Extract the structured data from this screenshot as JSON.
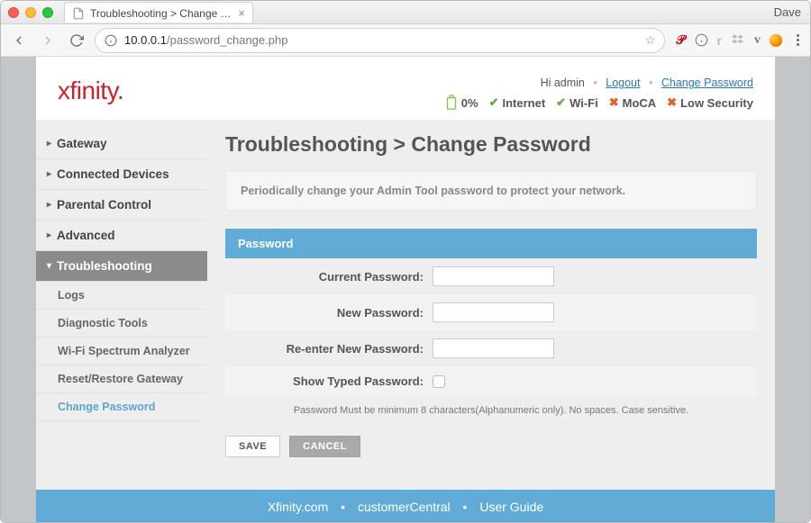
{
  "browser": {
    "profile_name": "Dave",
    "tab_title": "Troubleshooting > Change Pas",
    "url_host": "10.0.0.1",
    "url_path": "/password_change.php"
  },
  "header": {
    "logo_text": "xfinity",
    "greeting": "Hi admin",
    "logout_label": "Logout",
    "change_pw_label": "Change Password",
    "battery_pct": "0%",
    "status": {
      "internet": "Internet",
      "wifi": "Wi-Fi",
      "moca": "MoCA",
      "security": "Low Security"
    }
  },
  "sidebar": {
    "items": [
      {
        "label": "Gateway"
      },
      {
        "label": "Connected Devices"
      },
      {
        "label": "Parental Control"
      },
      {
        "label": "Advanced"
      },
      {
        "label": "Troubleshooting"
      }
    ],
    "sub": [
      {
        "label": "Logs"
      },
      {
        "label": "Diagnostic Tools"
      },
      {
        "label": "Wi-Fi Spectrum Analyzer"
      },
      {
        "label": "Reset/Restore Gateway"
      },
      {
        "label": "Change Password"
      }
    ]
  },
  "content": {
    "title": "Troubleshooting > Change Password",
    "notice": "Periodically change your Admin Tool password to protect your network.",
    "panel_title": "Password",
    "labels": {
      "current": "Current Password:",
      "new": "New Password:",
      "reenter": "Re-enter New Password:",
      "show": "Show Typed Password:"
    },
    "hint": "Password Must be minimum 8 characters(Alphanumeric only). No spaces. Case sensitive.",
    "save_label": "SAVE",
    "cancel_label": "CANCEL"
  },
  "footer": {
    "link1": "Xfinity.com",
    "link2": "customerCentral",
    "link3": "User Guide"
  }
}
